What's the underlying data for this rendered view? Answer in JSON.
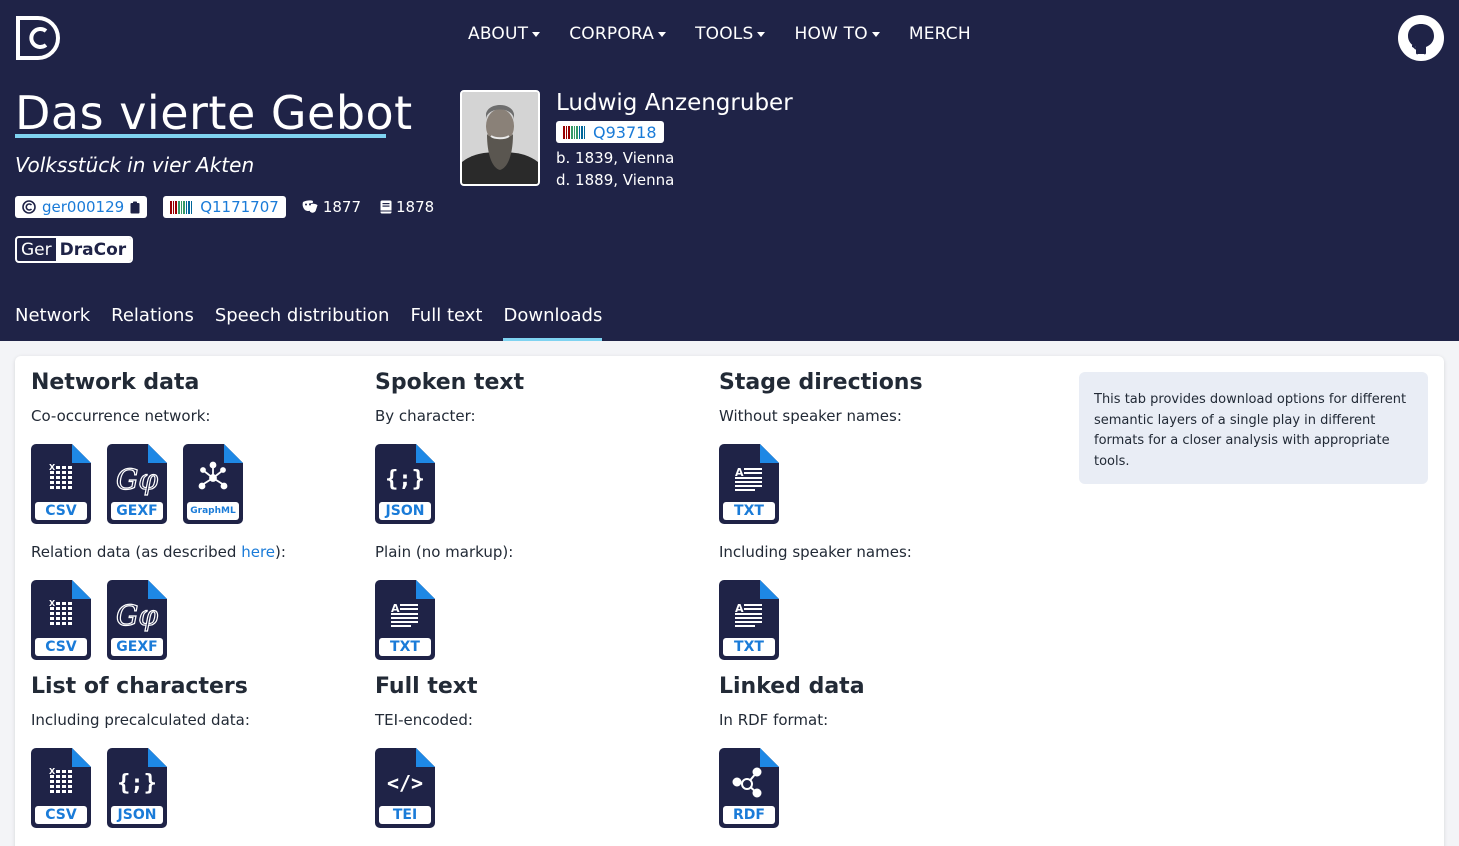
{
  "nav": {
    "items": [
      {
        "label": "ABOUT",
        "dropdown": true
      },
      {
        "label": "CORPORA",
        "dropdown": true
      },
      {
        "label": "TOOLS",
        "dropdown": true
      },
      {
        "label": "HOW TO",
        "dropdown": true
      },
      {
        "label": "MERCH",
        "dropdown": false
      }
    ],
    "logo_icon": "dracor-logo-icon",
    "github_icon": "github-icon"
  },
  "play": {
    "title": "Das vierte Gebot",
    "subtitle": "Volksstück in vier Akten",
    "id": "ger000129",
    "wikidata": "Q1171707",
    "premiere_year": "1877",
    "print_year": "1878",
    "corpus_prefix": "Ger",
    "corpus_name": "DraCor"
  },
  "author": {
    "name": "Ludwig Anzengruber",
    "wikidata": "Q93718",
    "born": "b. 1839, Vienna",
    "died": "d. 1889, Vienna"
  },
  "tabs": [
    {
      "label": "Network",
      "active": false
    },
    {
      "label": "Relations",
      "active": false
    },
    {
      "label": "Speech distribution",
      "active": false
    },
    {
      "label": "Full text",
      "active": false
    },
    {
      "label": "Downloads",
      "active": true
    }
  ],
  "downloads": {
    "network": {
      "title": "Network data",
      "cooccurrence_label": "Co-occurrence network:",
      "cooccurrence_formats": [
        "CSV",
        "GEXF",
        "GraphML"
      ],
      "relation_label_before": "Relation data (as described ",
      "relation_link": "here",
      "relation_label_after": "):",
      "relation_formats": [
        "CSV",
        "GEXF"
      ]
    },
    "spoken": {
      "title": "Spoken text",
      "by_character_label": "By character:",
      "by_character_formats": [
        "JSON"
      ],
      "plain_label": "Plain (no markup):",
      "plain_formats": [
        "TXT"
      ]
    },
    "stage": {
      "title": "Stage directions",
      "without_label": "Without speaker names:",
      "without_formats": [
        "TXT"
      ],
      "including_label": "Including speaker names:",
      "including_formats": [
        "TXT"
      ]
    },
    "characters": {
      "title": "List of characters",
      "label": "Including precalculated data:",
      "formats": [
        "CSV",
        "JSON"
      ]
    },
    "fulltext": {
      "title": "Full text",
      "label": "TEI-encoded:",
      "formats": [
        "TEI"
      ]
    },
    "linked": {
      "title": "Linked data",
      "label": "In RDF format:",
      "formats": [
        "RDF"
      ]
    },
    "info_text": "This tab provides download options for different semantic layers of a single play in different formats for a closer analysis with appropriate tools."
  },
  "colors": {
    "header_bg": "#1f2347",
    "accent": "#7fd3f1",
    "link": "#1a7bd8",
    "file_icon": "#1f2347",
    "file_corner": "#1e88e5"
  }
}
